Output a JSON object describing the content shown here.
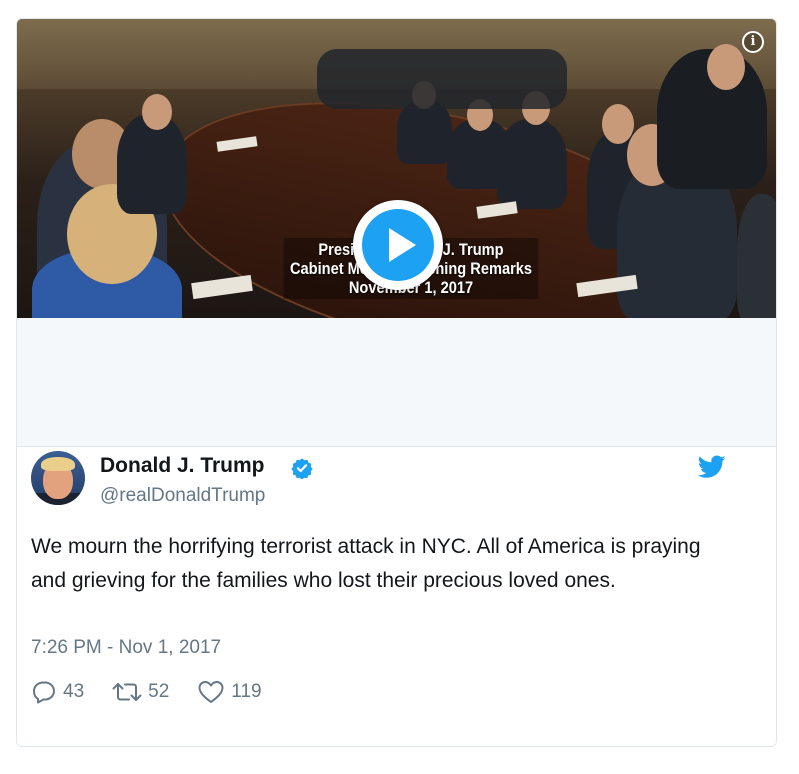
{
  "video": {
    "caption_line1": "President Donald J. Trump",
    "caption_line2": "Cabinet Meeting Opening Remarks",
    "caption_line3": "November 1, 2017",
    "info_icon": "info-icon",
    "play_icon": "play-icon"
  },
  "tweet": {
    "display_name": "Donald J. Trump",
    "handle": "@realDonaldTrump",
    "text": "We mourn the horrifying terrorist attack in NYC. All of America is praying and grieving for the families who lost their precious loved ones.",
    "timestamp": "7:26 PM - Nov 1, 2017",
    "replies": "43",
    "retweets": "52",
    "likes": "119"
  },
  "colors": {
    "accent": "#1da1f2",
    "muted": "#657786",
    "text": "#14171a",
    "border": "#e1e8ed"
  }
}
